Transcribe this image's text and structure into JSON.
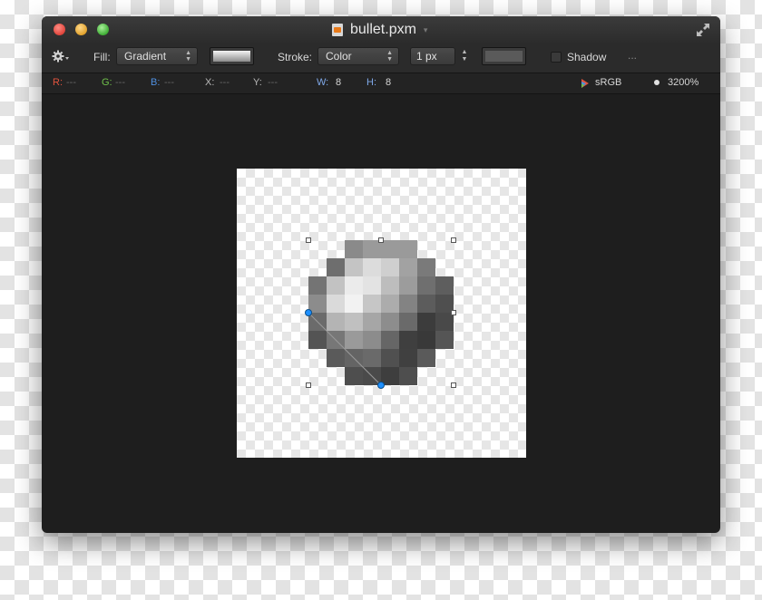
{
  "window": {
    "title": "bullet.pxm",
    "icons": {
      "close": "close-button",
      "minimize": "minimize-button",
      "zoom": "zoom-button",
      "fullscreen": "fullscreen-arrows-icon",
      "document": "pxm-document-icon"
    }
  },
  "toolbar": {
    "fill_label": "Fill:",
    "fill_value": "Gradient",
    "stroke_label": "Stroke:",
    "stroke_value": "Color",
    "stroke_width": "1 px",
    "shadow_label": "Shadow",
    "more_label": "...",
    "shadow_checked": false
  },
  "status": {
    "r_label": "R:",
    "r_value": "---",
    "g_label": "G:",
    "g_value": "---",
    "b_label": "B:",
    "b_value": "---",
    "x_label": "X:",
    "x_value": "---",
    "y_label": "Y:",
    "y_value": "---",
    "w_label": "W:",
    "w_value": "8",
    "h_label": "H:",
    "h_value": "8",
    "color_profile": "sRGB",
    "zoom": "3200%"
  },
  "colors": {
    "r_label": "#e0533d",
    "g_label": "#6fc04a",
    "b_label": "#4f8fe0",
    "w_label": "#7fa8e8",
    "h_label": "#7fa8e8",
    "selection_handle": "#1e90ff"
  },
  "canvas": {
    "pixels": [
      [
        null,
        null,
        "#8a8a8a",
        "#9a9a9a",
        "#9a9a9a",
        "#9a9a9a",
        null,
        null
      ],
      [
        null,
        "#6e6e6e",
        "#c4c4c4",
        "#dcdcdc",
        "#cfcfcf",
        "#a2a2a2",
        "#7a7a7a",
        null
      ],
      [
        "#747474",
        "#c2c2c2",
        "#ebebeb",
        "#e3e3e3",
        "#bdbdbd",
        "#9c9c9c",
        "#6f6f6f",
        "#5e5e5e"
      ],
      [
        "#8c8c8c",
        "#dadada",
        "#f2f2f2",
        "#c6c6c6",
        "#acacac",
        "#838383",
        "#5c5c5c",
        "#4f4f4f"
      ],
      [
        "#6b6b6b",
        "#b4b4b4",
        "#c0c0c0",
        "#a6a6a6",
        "#8d8d8d",
        "#6a6a6a",
        "#3c3c3c",
        "#494949"
      ],
      [
        "#545454",
        "#777777",
        "#9a9a9a",
        "#8c8c8c",
        "#666666",
        "#3f3f3f",
        "#393939",
        "#555555"
      ],
      [
        null,
        "#5a5a5a",
        "#646464",
        "#6a6a6a",
        "#505050",
        "#404040",
        "#5a5a5a",
        null
      ],
      [
        null,
        null,
        "#4e4e4e",
        "#4a4a4a",
        "#3e3e3e",
        "#4e4e4e",
        null,
        null
      ]
    ]
  }
}
